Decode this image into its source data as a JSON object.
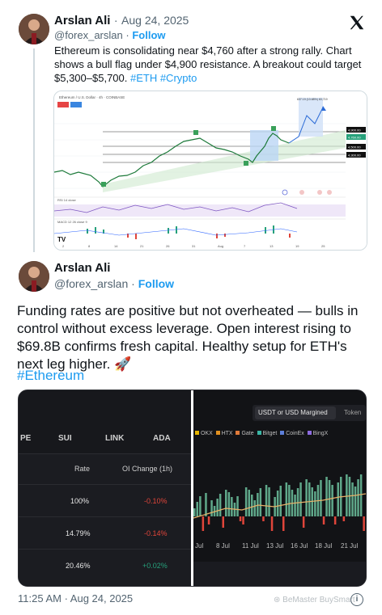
{
  "quoted": {
    "author_name": "Arslan Ali",
    "date": "Aug 24, 2025",
    "dot": "·",
    "handle": "@forex_arslan",
    "follow_label": "Follow",
    "text": "Ethereum is consolidating near $4,760 after a strong rally. Chart shows a bull flag under $4,900 resistance. A breakout could target $5,300–$5,700. ",
    "hashtags": "#ETH #Crypto",
    "chart": {
      "header": "Ethereum / U.S. Dollar · 4h · COINBASE",
      "price_tags": [
        "4,900.00",
        "4,760.00",
        "4,500.00",
        "4,300.00"
      ],
      "x_ticks": [
        "2",
        "8",
        "14",
        "21",
        "26",
        "31",
        "Aug",
        "7",
        "13",
        "19",
        "25"
      ],
      "projection_label": "637.19 (13.68%) 63,719",
      "rsi_label": "RSI 14 close",
      "macd_label": "MACD 12 26 close 9",
      "logo": "TV"
    }
  },
  "main": {
    "author_name": "Arslan Ali",
    "handle": "@forex_arslan",
    "dot": "·",
    "follow_label": "Follow",
    "text": "Funding rates are positive but not overheated — bulls in control without excess leverage. Open interest rising to $69.8B confirms fresh capital. Healthy setup for ETH's next leg higher. 🚀",
    "hashtag": "#Ethereum",
    "timestamp": "11:25 AM · Aug 24, 2025"
  },
  "left_panel": {
    "coins": [
      "PE",
      "SUI",
      "LINK",
      "ADA"
    ],
    "col_rate": "Rate",
    "col_oi": "OI Change (1h)",
    "rows": [
      {
        "rate": "100%",
        "oi": "-0.10%",
        "oi_color": "#e0453a"
      },
      {
        "rate": "14.79%",
        "oi": "-0.14%",
        "oi_color": "#e0453a"
      },
      {
        "rate": "20.46%",
        "oi": "+0.02%",
        "oi_color": "#26a17b"
      }
    ]
  },
  "right_panel": {
    "toggle_active": "USDT or USD Margined",
    "toggle_other": "Token",
    "legend": [
      "OKX",
      "HTX",
      "Gate",
      "Bitget",
      "CoinEx",
      "BingX"
    ],
    "legend_colors": [
      "#e4b400",
      "#e09020",
      "#e07a3a",
      "#3ab6a5",
      "#5d7fd9",
      "#8d6be0"
    ],
    "dates": [
      "Jul",
      "8 Jul",
      "11 Jul",
      "13 Jul",
      "16 Jul",
      "18 Jul",
      "21 Jul"
    ]
  },
  "watermark": "BeMaster BuySmart",
  "colors": {
    "accent": "#1d9bf0",
    "up": "#26a17b",
    "down": "#e0453a"
  }
}
